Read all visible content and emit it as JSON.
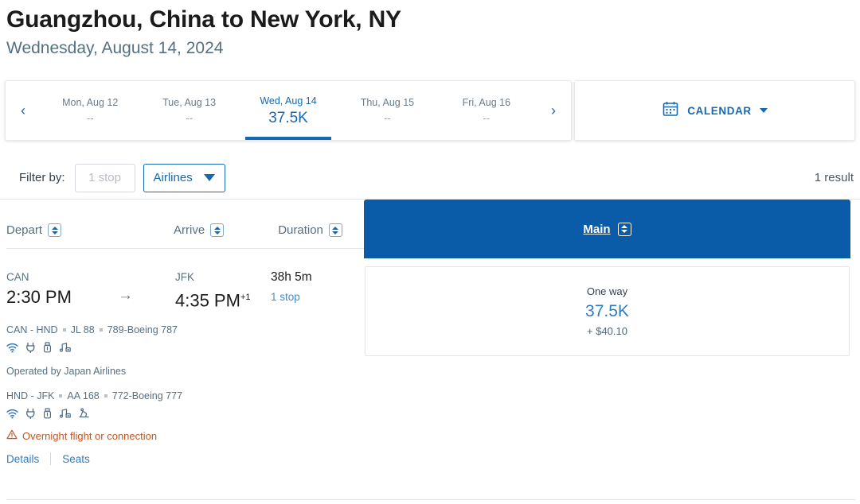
{
  "header": {
    "title": "Guangzhou, China to New York, NY",
    "subtitle": "Wednesday, August 14, 2024"
  },
  "datebar": {
    "prev_icon": "chevron-left-icon",
    "next_icon": "chevron-right-icon",
    "prev_label": "‹",
    "next_label": "›",
    "dates": [
      {
        "label": "Mon, Aug 12",
        "value": "--",
        "selected": false
      },
      {
        "label": "Tue, Aug 13",
        "value": "--",
        "selected": false
      },
      {
        "label": "Wed, Aug 14",
        "value": "37.5K",
        "selected": true
      },
      {
        "label": "Thu, Aug 15",
        "value": "--",
        "selected": false
      },
      {
        "label": "Fri, Aug 16",
        "value": "--",
        "selected": false
      }
    ],
    "calendar_button": {
      "label": "CALENDAR",
      "icon": "calendar-icon",
      "caret": "chevron-down-icon"
    }
  },
  "filters": {
    "label": "Filter by:",
    "stops_chip": {
      "label": "1 stop",
      "enabled": false
    },
    "airlines_chip": {
      "label": "Airlines",
      "enabled": true
    },
    "result_count": "1 result"
  },
  "columns": {
    "depart": "Depart",
    "arrive": "Arrive",
    "duration": "Duration",
    "fare_class": "Main"
  },
  "result": {
    "depart": {
      "code": "CAN",
      "time": "2:30 PM"
    },
    "arrive": {
      "code": "JFK",
      "time": "4:35 PM",
      "day_offset": "+1"
    },
    "duration": {
      "total": "38h 5m",
      "stops": "1 stop"
    },
    "segments": [
      {
        "route": "CAN - HND",
        "flight_number": "JL 88",
        "aircraft": "789-Boeing 787",
        "amenities": [
          "wifi-icon",
          "power-icon",
          "usb-icon",
          "entertainment-icon"
        ]
      },
      {
        "route": "HND - JFK",
        "flight_number": "AA 168",
        "aircraft": "772-Boeing 777",
        "amenities": [
          "wifi-icon",
          "power-icon",
          "usb-icon",
          "entertainment-icon",
          "lie-flat-seat-icon"
        ]
      }
    ],
    "operated_by": "Operated by Japan Airlines",
    "warning": {
      "icon": "warning-triangle-icon",
      "text": "Overnight flight or connection"
    },
    "links": {
      "details": "Details",
      "seats": "Seats"
    },
    "fare": {
      "trip_type": "One way",
      "miles": "37.5K",
      "taxes": "+ $40.10"
    }
  },
  "colors": {
    "brand_blue": "#0b5ca8",
    "link_blue": "#2e7cc0",
    "accent_blue": "#1668b3",
    "warning_orange": "#c05621"
  }
}
